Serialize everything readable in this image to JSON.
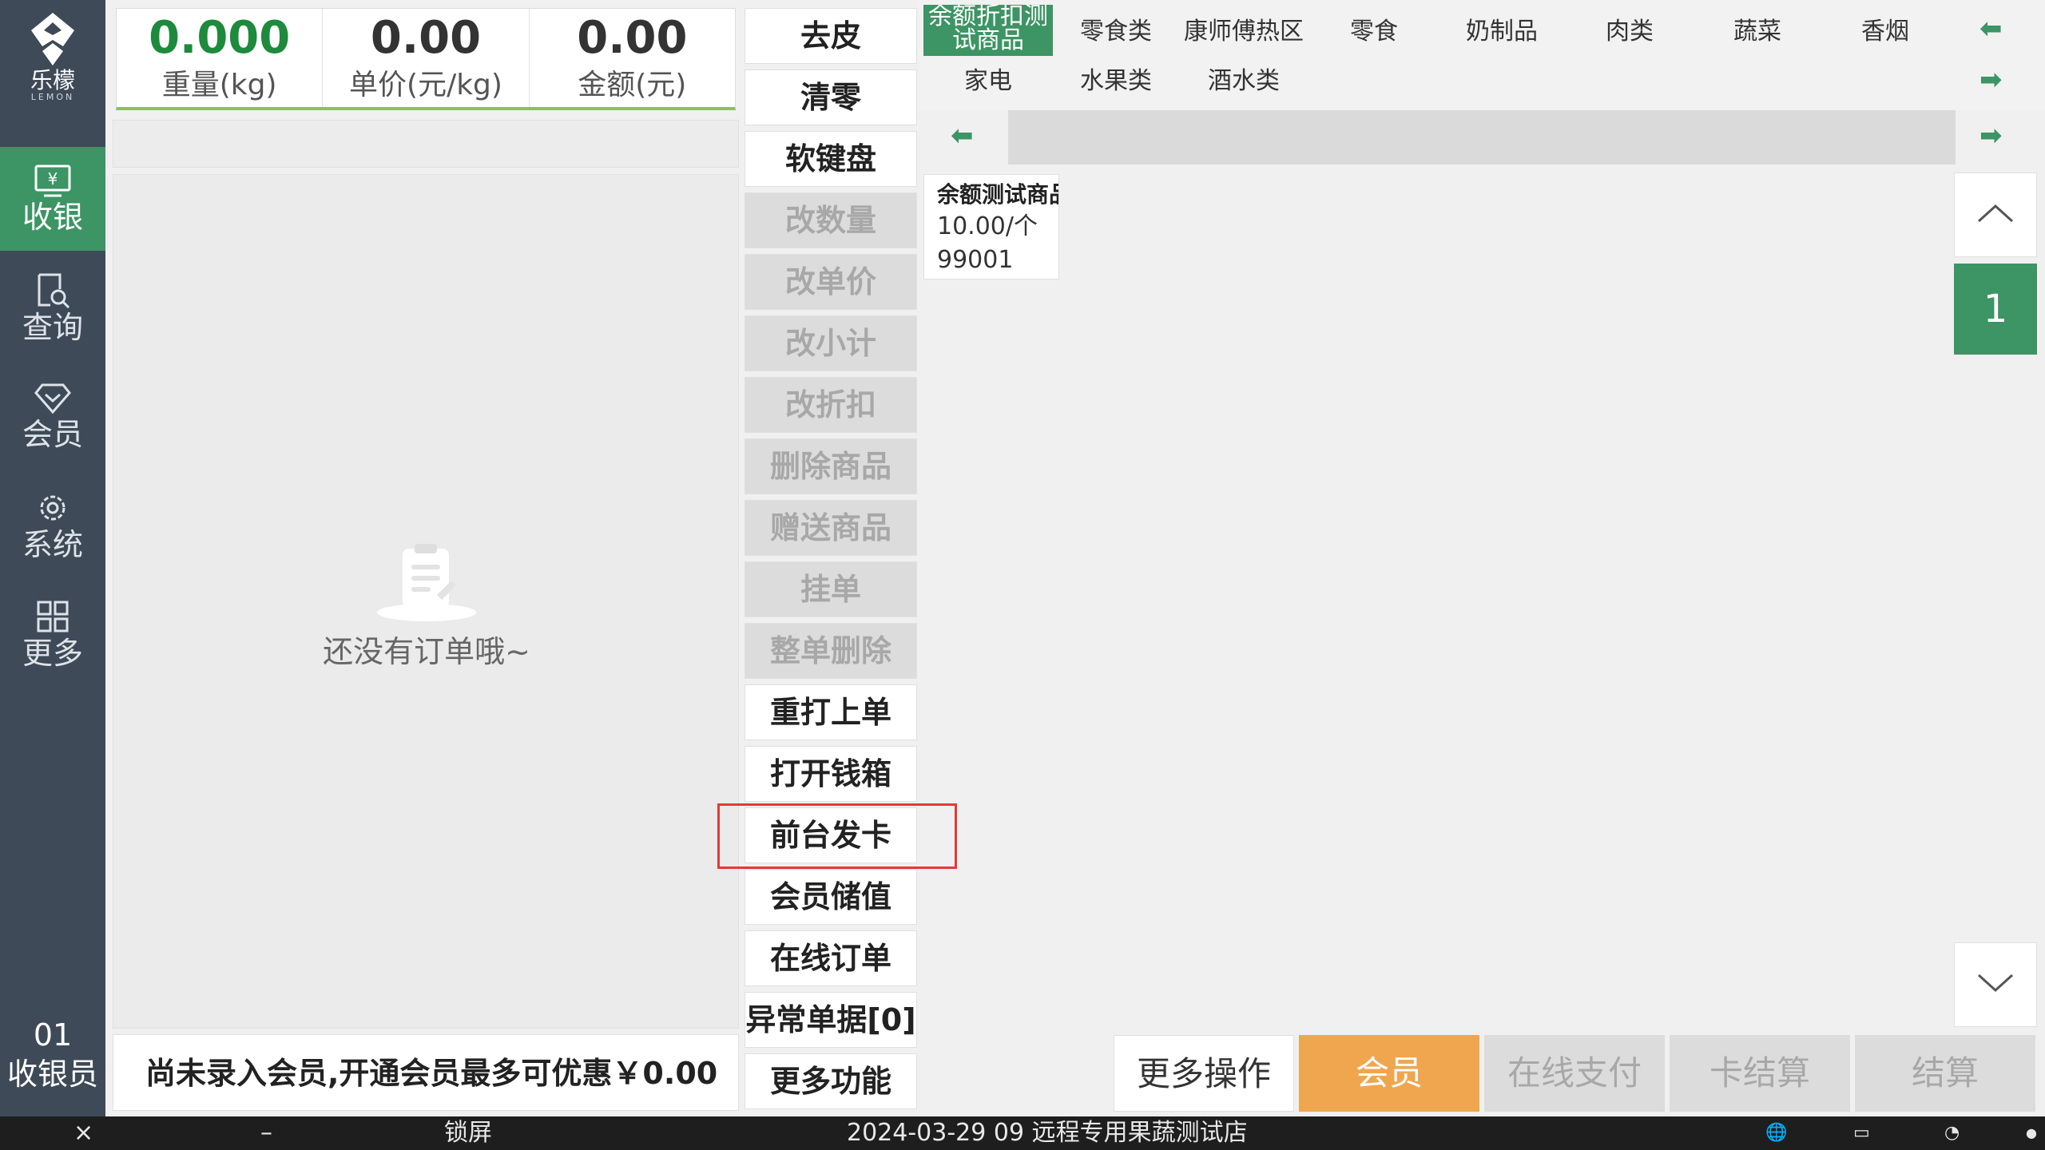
{
  "app": {
    "logo_name": "乐檬",
    "logo_sub": "LEMON"
  },
  "sidebar": {
    "items": [
      {
        "label": "收银",
        "icon": "cashier-icon",
        "active": true
      },
      {
        "label": "查询",
        "icon": "query-icon"
      },
      {
        "label": "会员",
        "icon": "diamond-icon"
      },
      {
        "label": "系统",
        "icon": "gear-icon"
      },
      {
        "label": "更多",
        "icon": "grid-icon"
      }
    ],
    "cashier_number": "01",
    "cashier_label": "收银员"
  },
  "display": {
    "weight_value": "0.000",
    "weight_unit": "重量(kg)",
    "price_value": "0.00",
    "price_unit": "单价(元/kg)",
    "amount_value": "0.00",
    "amount_unit": "金额(元)"
  },
  "order": {
    "empty_text": "还没有订单哦~"
  },
  "member_hint": "尚未录入会员,开通会员最多可优惠￥0.00",
  "functions": [
    {
      "label": "去皮",
      "enabled": true
    },
    {
      "label": "清零",
      "enabled": true
    },
    {
      "label": "软键盘",
      "enabled": true
    },
    {
      "label": "改数量",
      "enabled": false
    },
    {
      "label": "改单价",
      "enabled": false
    },
    {
      "label": "改小计",
      "enabled": false
    },
    {
      "label": "改折扣",
      "enabled": false
    },
    {
      "label": "删除商品",
      "enabled": false
    },
    {
      "label": "赠送商品",
      "enabled": false
    },
    {
      "label": "挂单",
      "enabled": false
    },
    {
      "label": "整单删除",
      "enabled": false
    },
    {
      "label": "重打上单",
      "enabled": true
    },
    {
      "label": "打开钱箱",
      "enabled": true
    },
    {
      "label": "前台发卡",
      "enabled": true,
      "highlighted": true
    },
    {
      "label": "会员储值",
      "enabled": true
    },
    {
      "label": "在线订单",
      "enabled": true
    },
    {
      "label": "异常单据[0]",
      "enabled": true
    },
    {
      "label": "更多功能",
      "enabled": true
    }
  ],
  "categories": {
    "active": "余额折扣测试商品",
    "row1": [
      "零食类",
      "康师傅热区",
      "零食",
      "奶制品",
      "肉类",
      "蔬菜",
      "香烟"
    ],
    "row2": [
      "家电",
      "水果类",
      "酒水类"
    ]
  },
  "products": [
    {
      "name": "余额测试商品",
      "price": "10.00/个",
      "code": "99001"
    }
  ],
  "pager": {
    "current_page": "1"
  },
  "actions": {
    "more": "更多操作",
    "member": "会员",
    "online_pay": "在线支付",
    "card_pay": "卡结算",
    "checkout": "结算"
  },
  "taskbar": {
    "close": "×",
    "minimize": "–",
    "lock": "锁屏",
    "status": "2024-03-29 09 远程专用果蔬测试店"
  },
  "colors": {
    "accent_green": "#3d9464",
    "member_orange": "#f0a64e",
    "sidebar_bg": "#3e4a57",
    "weight_green": "#1d8a3c",
    "highlight_red": "#e53935"
  }
}
